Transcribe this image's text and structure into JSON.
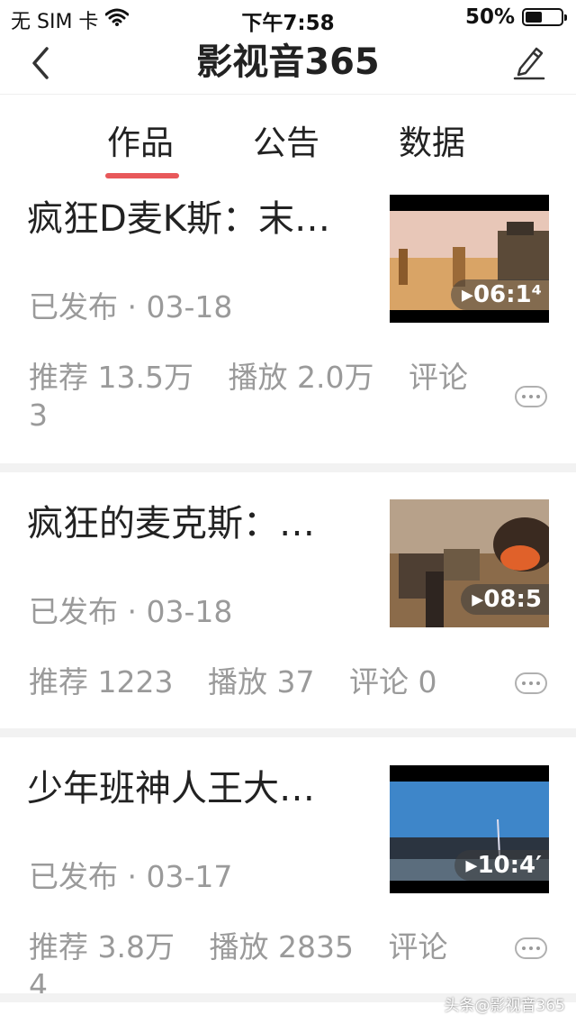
{
  "status_bar": {
    "carrier": "无 SIM 卡",
    "time": "下午7:58",
    "battery_percent": "50%",
    "battery_level": 0.5,
    "icons": [
      "wifi-icon",
      "battery-icon"
    ]
  },
  "nav": {
    "title": "影视音365",
    "back_icon": "chevron-left-icon",
    "edit_icon": "edit-icon"
  },
  "tabs": [
    {
      "label": "作品",
      "active": true
    },
    {
      "label": "公告",
      "active": false
    },
    {
      "label": "数据",
      "active": false
    }
  ],
  "accent_color": "#e8585a",
  "items": [
    {
      "title": "疯狂D麦K斯：末…",
      "status": "已发布 · 03-18",
      "duration": "06:1⁴",
      "stats": {
        "rec_label": "推荐",
        "rec": "13.5万",
        "play_label": "播放",
        "play": "2.0万",
        "comment_label": "评论",
        "comment": "3"
      }
    },
    {
      "title": "疯狂的麦克斯：…",
      "status": "已发布 · 03-18",
      "duration": "08:5",
      "stats": {
        "rec_label": "推荐",
        "rec": "1223",
        "play_label": "播放",
        "play": "37",
        "comment_label": "评论",
        "comment": "0"
      }
    },
    {
      "title": "少年班神人王大…",
      "status": "已发布 · 03-17",
      "duration": "10:4′",
      "stats": {
        "rec_label": "推荐",
        "rec": "3.8万",
        "play_label": "播放",
        "play": "2835",
        "comment_label": "评论",
        "comment": "4"
      }
    }
  ],
  "watermark": "头条@影视音365"
}
